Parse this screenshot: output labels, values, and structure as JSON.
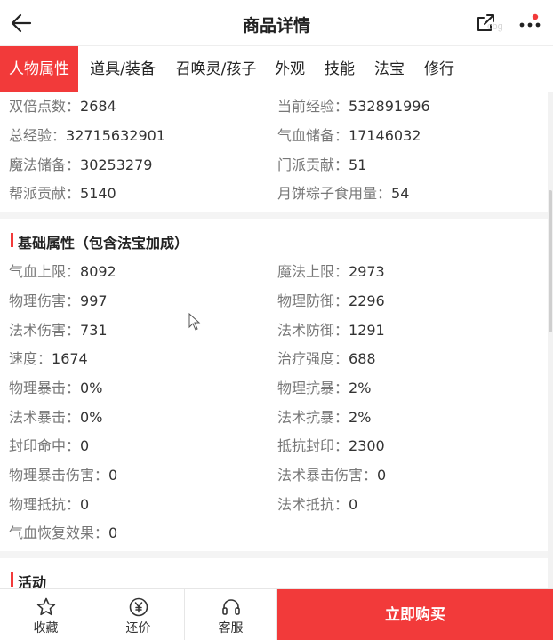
{
  "header": {
    "title": "商品详情",
    "watermark": "cbg"
  },
  "tabs": [
    {
      "label": "人物属性",
      "active": true
    },
    {
      "label": "道具/装备"
    },
    {
      "label": "召唤灵/孩子"
    },
    {
      "label": "外观"
    },
    {
      "label": "技能"
    },
    {
      "label": "法宝"
    },
    {
      "label": "修行"
    }
  ],
  "overview": [
    {
      "label": "双倍点数：",
      "value": "2684"
    },
    {
      "label": "当前经验：",
      "value": "532891996"
    },
    {
      "label": "总经验：",
      "value": "32715632901"
    },
    {
      "label": "气血储备：",
      "value": "17146032"
    },
    {
      "label": "魔法储备：",
      "value": "30253279"
    },
    {
      "label": "门派贡献：",
      "value": "51"
    },
    {
      "label": "帮派贡献：",
      "value": "5140"
    },
    {
      "label": "月饼粽子食用量：",
      "value": "54"
    }
  ],
  "basic": {
    "title": "基础属性（包含法宝加成）",
    "items": [
      {
        "label": "气血上限：",
        "value": "8092"
      },
      {
        "label": "魔法上限：",
        "value": "2973"
      },
      {
        "label": "物理伤害：",
        "value": "997"
      },
      {
        "label": "物理防御：",
        "value": "2296"
      },
      {
        "label": "法术伤害：",
        "value": "731"
      },
      {
        "label": "法术防御：",
        "value": "1291"
      },
      {
        "label": "速度：",
        "value": "1674"
      },
      {
        "label": "治疗强度：",
        "value": "688"
      },
      {
        "label": "物理暴击：",
        "value": "0%"
      },
      {
        "label": "物理抗暴：",
        "value": "2%"
      },
      {
        "label": "法术暴击：",
        "value": "0%"
      },
      {
        "label": "法术抗暴：",
        "value": "2%"
      },
      {
        "label": "封印命中：",
        "value": "0"
      },
      {
        "label": "抵抗封印：",
        "value": "2300"
      },
      {
        "label": "物理暴击伤害：",
        "value": "0"
      },
      {
        "label": "法术暴击伤害：",
        "value": "0"
      },
      {
        "label": "物理抵抗：",
        "value": "0"
      },
      {
        "label": "法术抵抗：",
        "value": "0"
      },
      {
        "label": "气血恢复效果：",
        "value": "0"
      }
    ]
  },
  "activity": {
    "title": "活动"
  },
  "bottom": {
    "favorite": "收藏",
    "bargain": "还价",
    "service": "客服",
    "buy": "立即购买"
  },
  "colors": {
    "accent": "#f23a3a"
  }
}
